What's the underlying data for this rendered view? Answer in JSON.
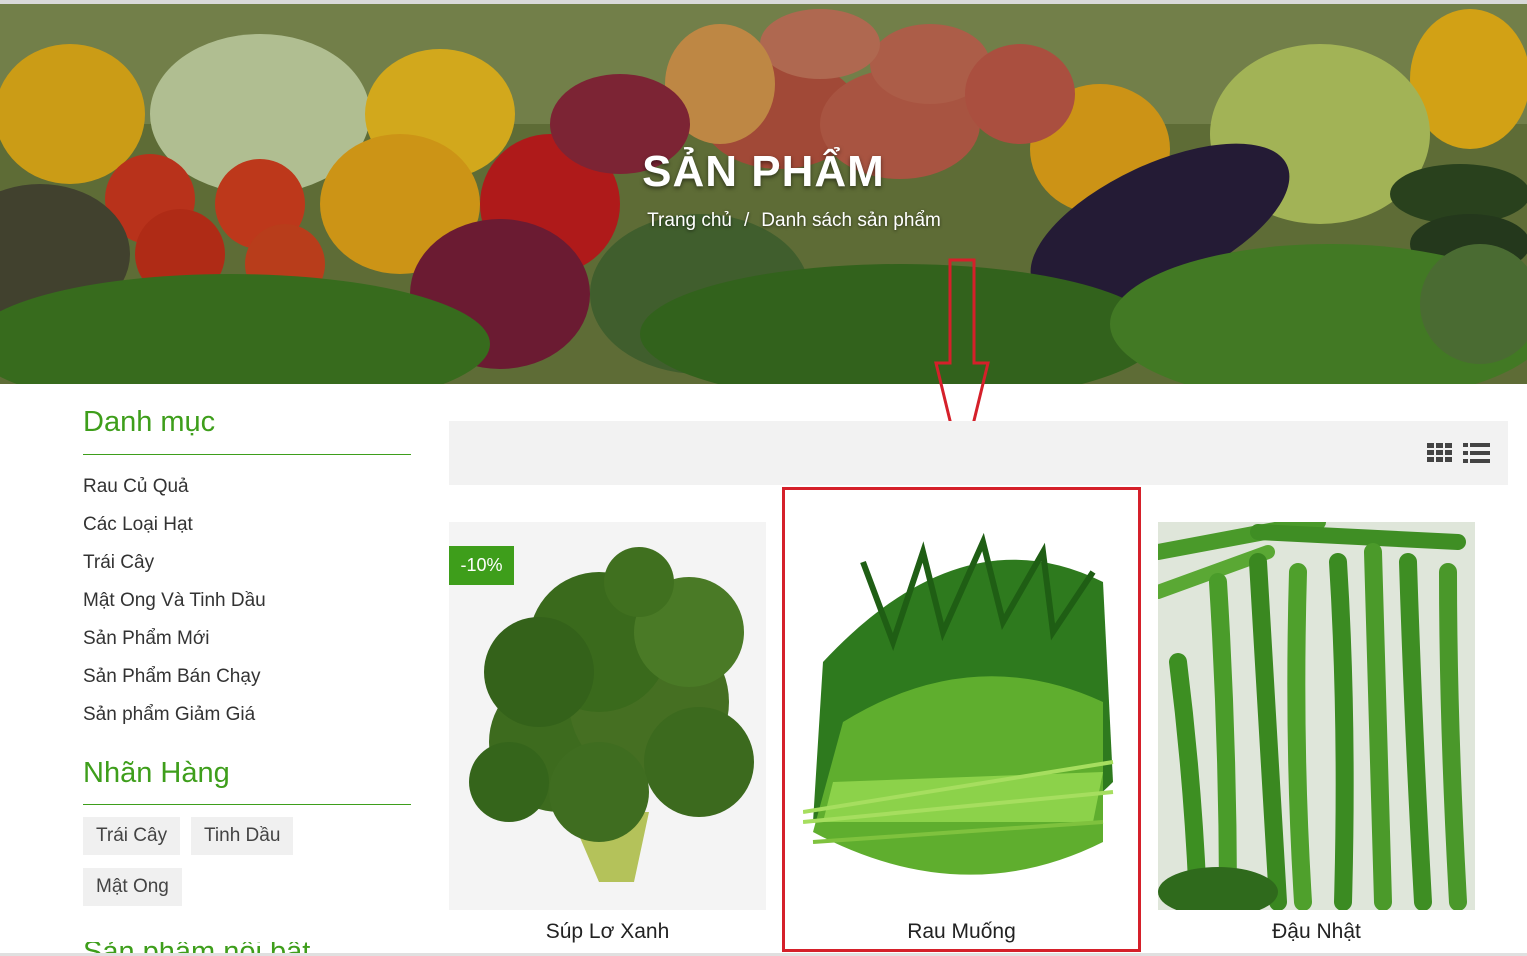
{
  "banner": {
    "title": "SẢN PHẨM",
    "breadcrumb": {
      "home": "Trang chủ",
      "separator": "/",
      "current": "Danh sách sản phẩm"
    }
  },
  "sidebar": {
    "categories_heading": "Danh mục",
    "categories": [
      "Rau Củ Quả",
      "Các Loại Hạt",
      "Trái Cây",
      "Mật Ong Và Tinh Dầu",
      "Sản Phẩm Mới",
      "Sản Phẩm Bán Chạy",
      "Sản phẩm Giảm Giá"
    ],
    "brands_heading": "Nhãn Hàng",
    "tags": [
      "Trái Cây",
      "Tinh Dầu",
      "Mật Ong"
    ],
    "next_heading_partial": "Sản phẩm nổi bật"
  },
  "toolbar": {
    "view_icons": [
      "grid-view-icon",
      "list-view-icon"
    ]
  },
  "products": [
    {
      "name": "Súp Lơ Xanh",
      "badge": "-10%",
      "image": "broccoli"
    },
    {
      "name": "Rau Muống",
      "image": "water-spinach",
      "highlighted": true
    },
    {
      "name": "Đậu Nhật",
      "image": "green-beans"
    }
  ],
  "colors": {
    "accent": "#3e9e1b",
    "highlight": "#d5202a",
    "toolbar_bg": "#f2f2f2"
  }
}
